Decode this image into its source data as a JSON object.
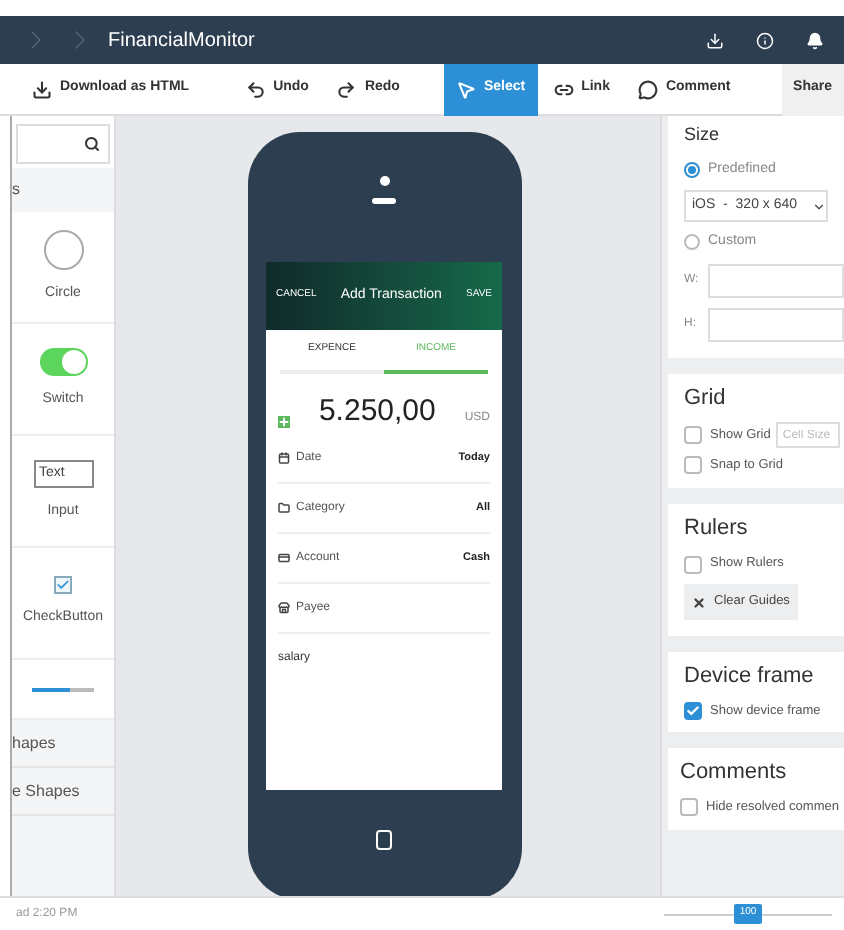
{
  "title_bar": {
    "title": "FinancialMonitor"
  },
  "toolbar": [
    {
      "kind": "download",
      "label": "Download as HTML",
      "selected": false
    },
    {
      "kind": "undo",
      "label": "Undo",
      "selected": false
    },
    {
      "kind": "redo",
      "label": "Redo",
      "selected": false
    },
    {
      "kind": "select",
      "label": "Select",
      "selected": true
    },
    {
      "kind": "link",
      "label": "Link",
      "selected": false
    },
    {
      "kind": "comment",
      "label": "Comment",
      "selected": false
    },
    {
      "kind": "share",
      "label": "Share",
      "selected": false
    }
  ],
  "left_panel": {
    "header": "s",
    "components": [
      {
        "kind": "circle",
        "label": "Circle"
      },
      {
        "kind": "switch",
        "label": "Switch",
        "on": true
      },
      {
        "kind": "input",
        "label": "Input",
        "value": "Text"
      },
      {
        "kind": "checkbox",
        "label": "CheckButton",
        "checked": true
      },
      {
        "kind": "slider",
        "level": 0.6
      }
    ],
    "sections": [
      "hapes",
      "e Shapes"
    ]
  },
  "phone": {
    "header": {
      "cancel": "CANCEL",
      "title": "Add Transaction",
      "save": "SAVE"
    },
    "tabs": [
      {
        "label": "EXPENCE",
        "selected": false
      },
      {
        "label": "INCOME",
        "selected": true
      }
    ],
    "amount": {
      "value": "5.250,00",
      "currency": "USD"
    },
    "fields": [
      {
        "kind": "date",
        "label": "Date",
        "value": "Today"
      },
      {
        "kind": "category",
        "label": "Category",
        "value": "All"
      },
      {
        "kind": "account",
        "label": "Account",
        "value": "Cash"
      },
      {
        "kind": "payee",
        "label": "Payee"
      }
    ],
    "note": "salary"
  },
  "right_panel": {
    "size": {
      "title": "Size",
      "options": [
        {
          "label": "Predefined",
          "selected": true
        },
        {
          "label": "Custom",
          "selected": false
        }
      ],
      "preset": "iOS  -  320 x 640",
      "w_label": "W:",
      "h_label": "H:"
    },
    "grid": {
      "title": "Grid",
      "show_grid": {
        "label": "Show Grid",
        "checked": false
      },
      "cell_size_placeholder": "Cell Size",
      "snap": {
        "label": "Snap to Grid",
        "checked": false
      }
    },
    "rulers": {
      "title": "Rulers",
      "show_rulers": {
        "label": "Show Rulers",
        "checked": false
      },
      "clear_button": "Clear Guides"
    },
    "device_frame": {
      "title": "Device frame",
      "show": {
        "label": "Show device frame",
        "checked": true
      }
    },
    "comments": {
      "title": "Comments",
      "hide": {
        "label": "Hide resolved commen",
        "checked": false
      }
    }
  },
  "status_bar": {
    "text": "ad 2:20 PM",
    "zoom": "100"
  }
}
